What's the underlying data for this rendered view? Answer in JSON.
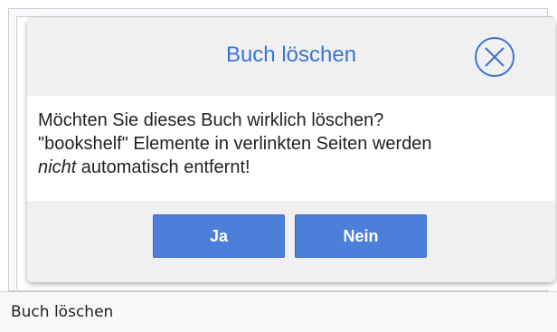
{
  "dialog": {
    "title": "Buch löschen",
    "close_icon": "close-circle-icon",
    "message_line1": "Möchten Sie dieses Buch wirklich löschen?",
    "message_line2": "\"bookshelf\" Elemente in verlinkten Seiten werden",
    "message_emphasis": "nicht",
    "message_line3_rest": " automatisch entfernt!",
    "buttons": {
      "yes_label": "Ja",
      "no_label": "Nein"
    }
  },
  "caption": {
    "text": "Buch löschen"
  },
  "colors": {
    "title": "#3b73d6",
    "button": "#4b7fd9",
    "panel": "#f0f0f0"
  }
}
